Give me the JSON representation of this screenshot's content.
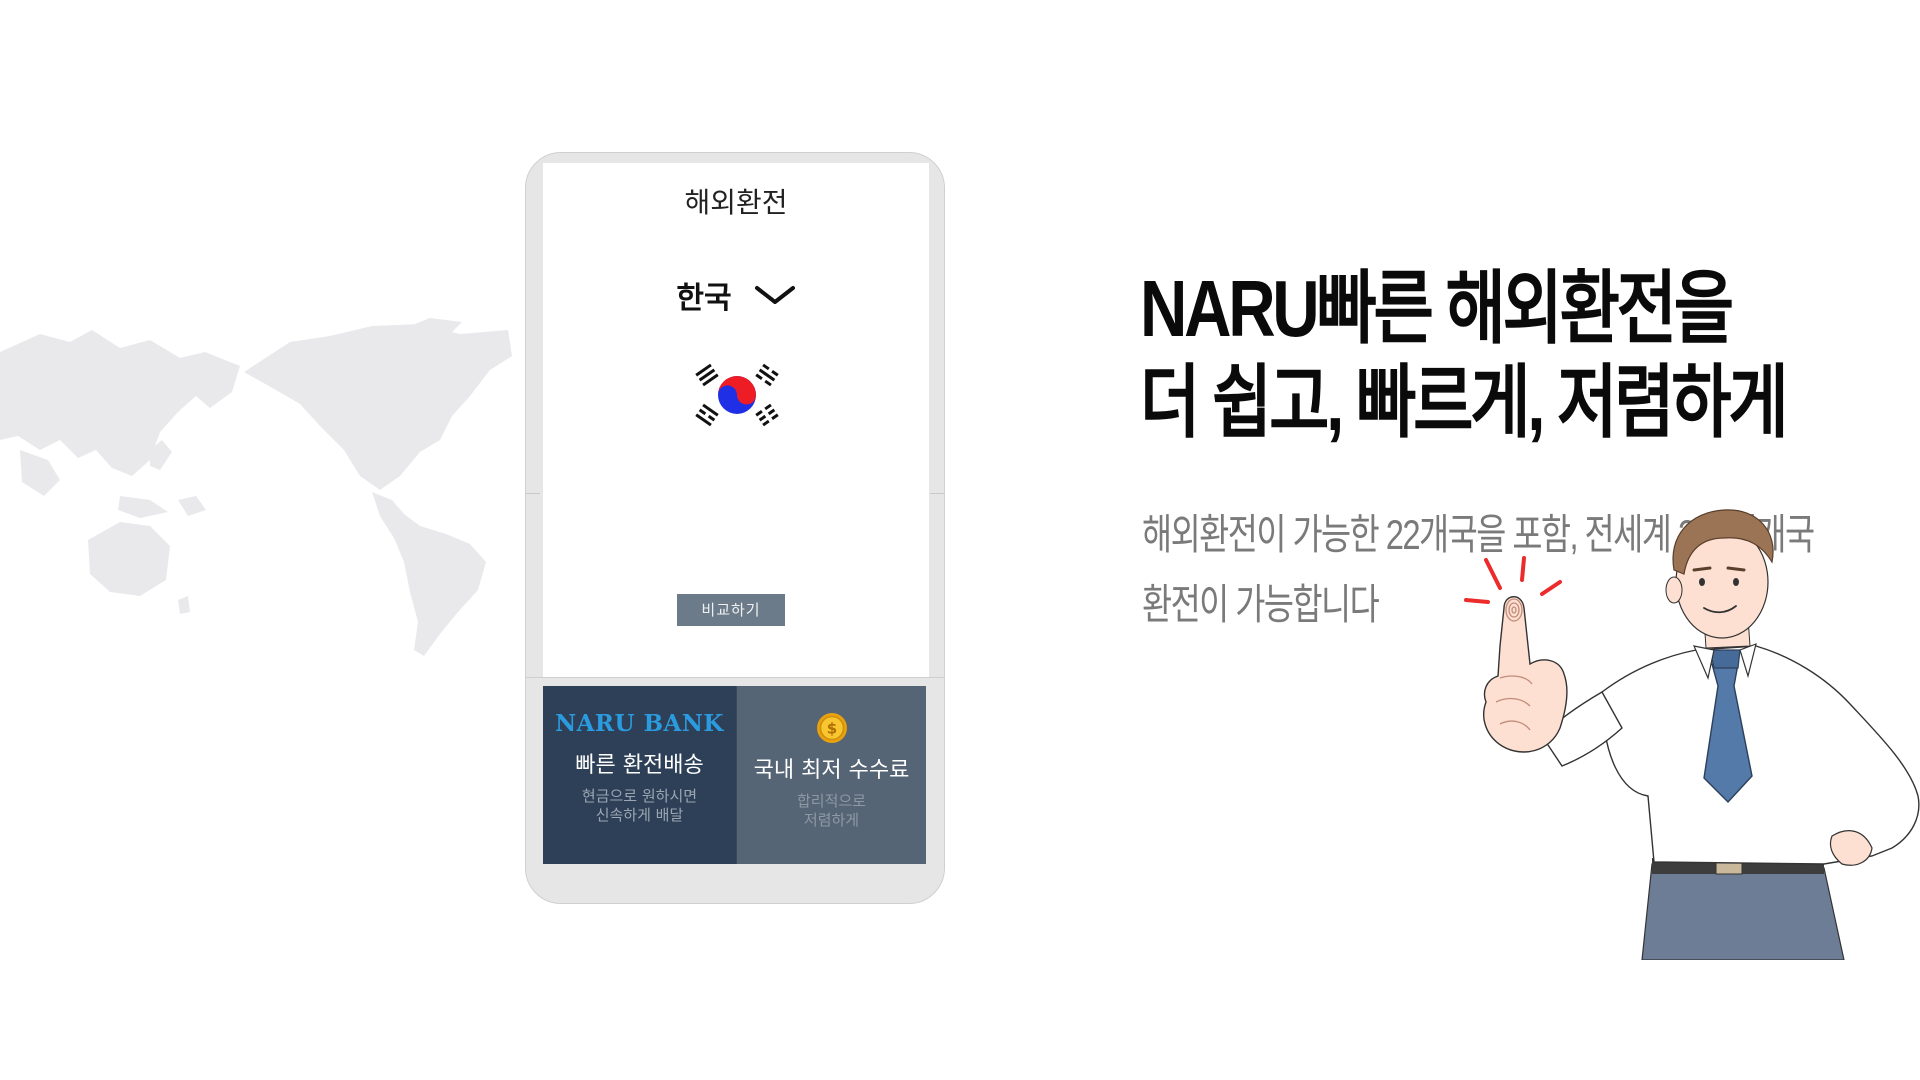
{
  "phone": {
    "title": "해외환전",
    "country": "한국",
    "compare_button": "비교하기",
    "cards": [
      {
        "brand": "NARU BANK",
        "heading": "빠른 환전배송",
        "sub_line1": "현금으로 원하시면",
        "sub_line2": "신속하게 배달"
      },
      {
        "icon": "coin-icon",
        "heading": "국내 최저 수수료",
        "sub_line1": "합리적으로",
        "sub_line2": "저렴하게"
      }
    ]
  },
  "headline": {
    "line1": "NARU빠른 해외환전을",
    "line2": "더 쉽고, 빠르게, 저렴하게"
  },
  "subtext": {
    "line1": "해외환전이 가능한 22개국을 포함, 전세계 200여개국",
    "line2": "환전이 가능합니다"
  },
  "colors": {
    "card_dark": "#2e4057",
    "card_slate": "#556575",
    "brand_blue": "#2b9be0",
    "button_grey": "#6b7b8a"
  }
}
